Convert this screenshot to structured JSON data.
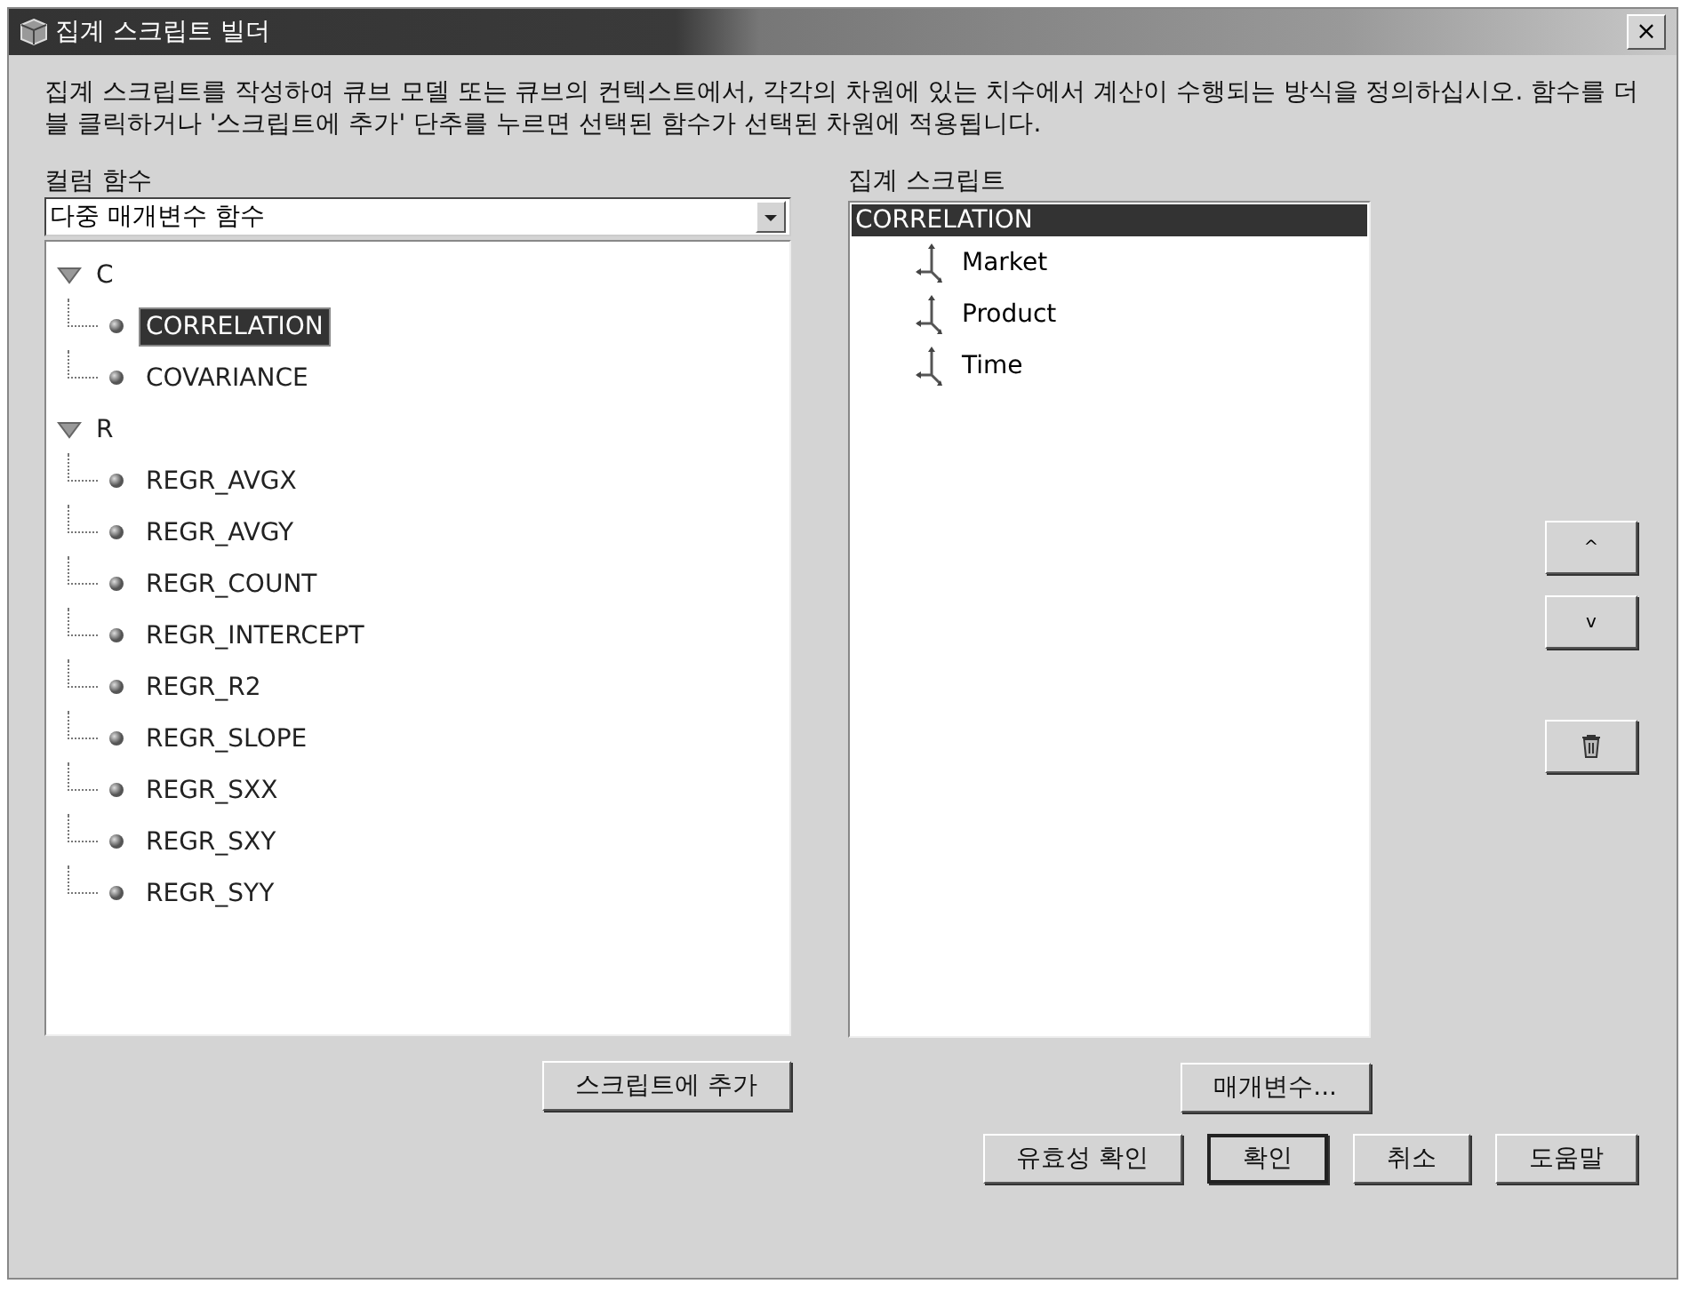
{
  "window": {
    "title": "집계 스크립트 빌더",
    "close": "×"
  },
  "description": "집계 스크립트를 작성하여 큐브 모델 또는 큐브의 컨텍스트에서, 각각의 차원에 있는 치수에서 계산이 수행되는 방식을 정의하십시오. 함수를 더블 클릭하거나 '스크립트에 추가' 단추를 누르면 선택된 함수가 선택된 차원에 적용됩니다.",
  "functions": {
    "label": "컬럼 함수",
    "dropdown": "다중 매개변수 함수",
    "tree": [
      {
        "label": "C",
        "expanded": true,
        "children": [
          {
            "label": "CORRELATION",
            "selected": true
          },
          {
            "label": "COVARIANCE",
            "selected": false
          }
        ]
      },
      {
        "label": "R",
        "expanded": true,
        "children": [
          {
            "label": "REGR_AVGX",
            "selected": false
          },
          {
            "label": "REGR_AVGY",
            "selected": false
          },
          {
            "label": "REGR_COUNT",
            "selected": false
          },
          {
            "label": "REGR_INTERCEPT",
            "selected": false
          },
          {
            "label": "REGR_R2",
            "selected": false
          },
          {
            "label": "REGR_SLOPE",
            "selected": false
          },
          {
            "label": "REGR_SXX",
            "selected": false
          },
          {
            "label": "REGR_SXY",
            "selected": false
          },
          {
            "label": "REGR_SYY",
            "selected": false
          }
        ]
      }
    ],
    "add_button": "스크립트에 추가"
  },
  "script": {
    "label": "집계 스크립트",
    "root": {
      "label": "CORRELATION",
      "selected": true,
      "children": [
        {
          "label": "Market"
        },
        {
          "label": "Product"
        },
        {
          "label": "Time"
        }
      ]
    },
    "parameters_button": "매개변수..."
  },
  "side_buttons": [
    {
      "kind": "text",
      "label": "^"
    },
    {
      "kind": "text",
      "label": "v"
    },
    {
      "kind": "trash"
    }
  ],
  "buttons": [
    {
      "label": "유효성 확인",
      "default": false
    },
    {
      "label": "확인",
      "default": true
    },
    {
      "label": "취소",
      "default": false
    },
    {
      "label": "도움말",
      "default": false
    }
  ]
}
